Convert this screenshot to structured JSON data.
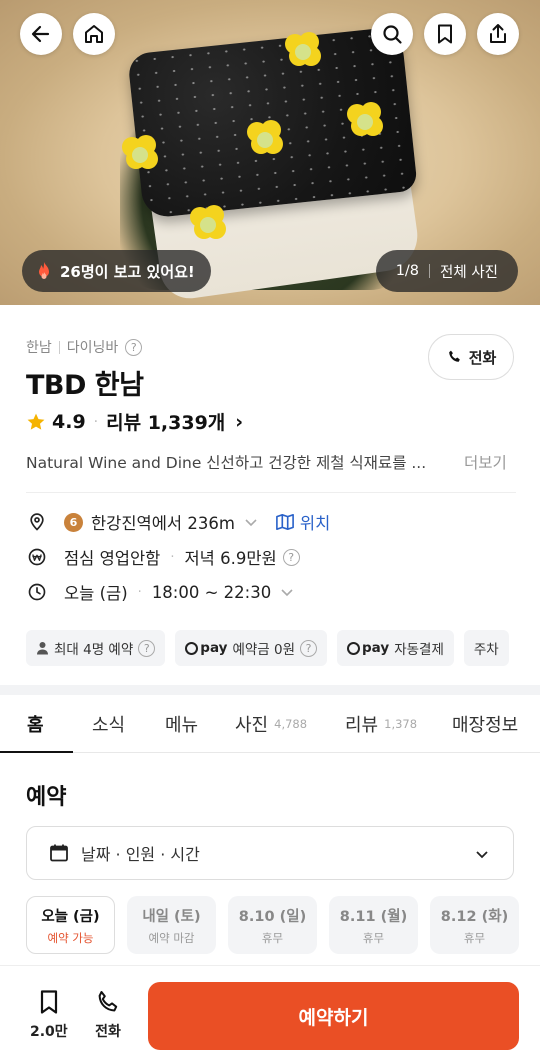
{
  "hero": {
    "viewing_text": "26명이 보고 있어요!",
    "photo_index": "1/8",
    "all_photos_label": "전체 사진",
    "top_buttons": [
      "back-icon",
      "home-icon",
      "search-icon",
      "bookmark-icon",
      "share-icon"
    ]
  },
  "info": {
    "categories": [
      "한남",
      "다이닝바"
    ],
    "call_label": "전화",
    "name": "TBD 한남",
    "rating": "4.9",
    "review_label": "리뷰 1,339개",
    "description": "Natural Wine and Dine  신선하고 건강한 제철 식재료를 ...",
    "more_label": "더보기",
    "location": {
      "line_number": "6",
      "text": "한강진역에서 236m",
      "map_label": "위치"
    },
    "price": {
      "lunch": "점심 영업안함",
      "dinner": "저녁 6.9만원"
    },
    "hours": {
      "day": "오늘 (금)",
      "time": "18:00 ~ 22:30"
    },
    "chips": {
      "max_people": "최대 4명 예약",
      "pay_brand": "pay",
      "deposit": "예약금 0원",
      "autopay": "자동결제",
      "parking": "주차"
    }
  },
  "tabs": [
    {
      "label": "홈",
      "count": ""
    },
    {
      "label": "소식",
      "count": ""
    },
    {
      "label": "메뉴",
      "count": ""
    },
    {
      "label": "사진",
      "count": "4,788"
    },
    {
      "label": "리뷰",
      "count": "1,378"
    },
    {
      "label": "매장정보",
      "count": ""
    }
  ],
  "reservation": {
    "title": "예약",
    "picker_label": "날짜 · 인원 · 시간",
    "days": [
      {
        "date": "오늘 (금)",
        "status": "예약 가능"
      },
      {
        "date": "내일 (토)",
        "status": "예약 마감"
      },
      {
        "date": "8.10 (일)",
        "status": "휴무"
      },
      {
        "date": "8.11 (월)",
        "status": "휴무"
      },
      {
        "date": "8.12 (화)",
        "status": "휴무"
      }
    ]
  },
  "bottom_bar": {
    "save_count": "2.0만",
    "call_label": "전화",
    "reserve_label": "예약하기"
  },
  "colors": {
    "accent": "#ea4f25",
    "link": "#2a62c9",
    "star": "#f5b301"
  }
}
